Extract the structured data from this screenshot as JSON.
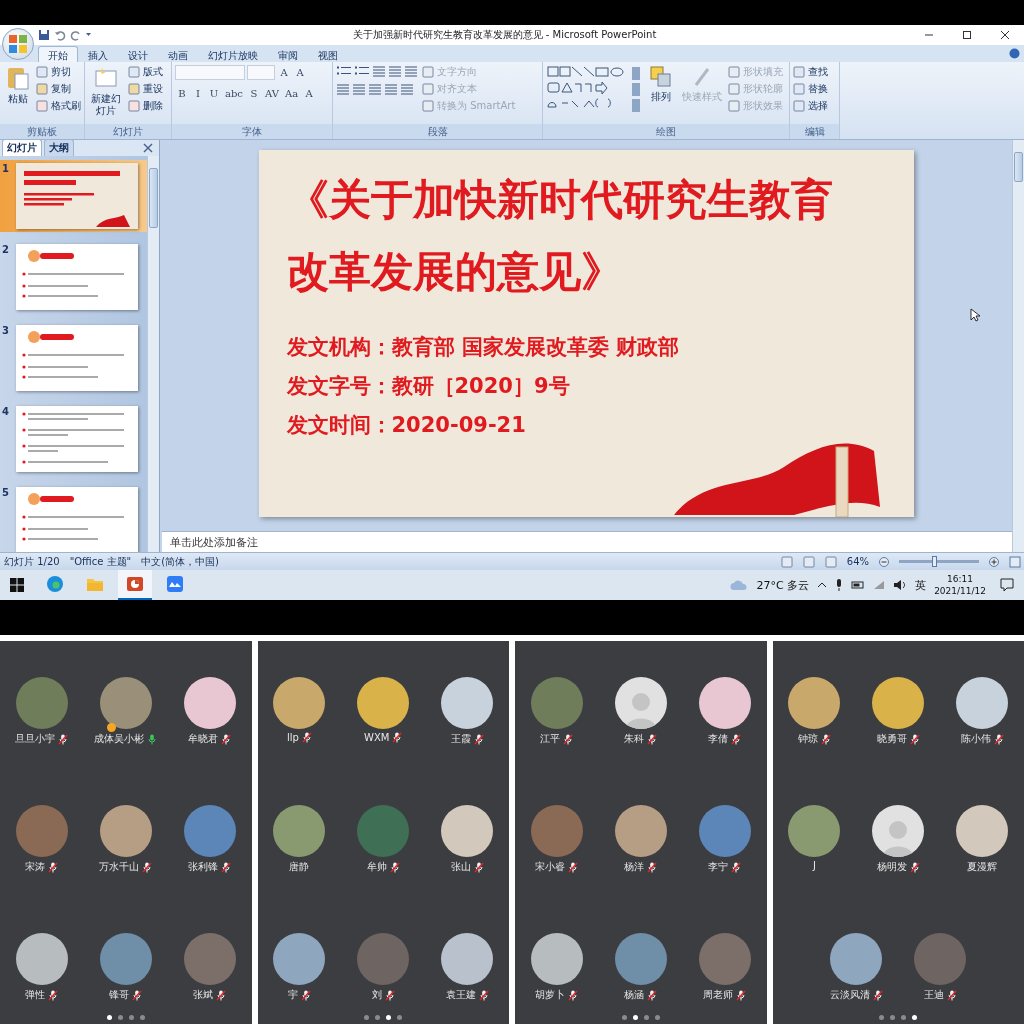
{
  "window": {
    "title": "关于加强新时代研究生教育改革发展的意见 - Microsoft PowerPoint"
  },
  "ribbon_tabs": [
    {
      "label": "开始",
      "selected": true
    },
    {
      "label": "插入",
      "selected": false
    },
    {
      "label": "设计",
      "selected": false
    },
    {
      "label": "动画",
      "selected": false
    },
    {
      "label": "幻灯片放映",
      "selected": false
    },
    {
      "label": "审阅",
      "selected": false
    },
    {
      "label": "视图",
      "selected": false
    }
  ],
  "ribbon_groups": [
    {
      "kind": "clipboard",
      "label": "剪贴板",
      "big_button": {
        "label": "粘贴",
        "disabled": false
      },
      "items": [
        {
          "label": "剪切",
          "disabled": false
        },
        {
          "label": "复制",
          "disabled": false
        },
        {
          "label": "格式刷",
          "disabled": false
        }
      ]
    },
    {
      "kind": "slides",
      "label": "幻灯片",
      "big_button": {
        "label": "新建幻灯片",
        "disabled": false
      },
      "items": [
        {
          "label": "版式",
          "disabled": false
        },
        {
          "label": "重设",
          "disabled": false
        },
        {
          "label": "删除",
          "disabled": false
        }
      ]
    },
    {
      "kind": "font",
      "label": "字体",
      "size_buttons": [
        "A",
        "A"
      ],
      "format_buttons": [
        "B",
        "I",
        "U",
        "abc",
        "S",
        "AV",
        "Aa",
        "A"
      ]
    },
    {
      "kind": "paragraph",
      "label": "段落",
      "items": [
        {
          "label": "文字方向",
          "disabled": true
        },
        {
          "label": "对齐文本",
          "disabled": true
        },
        {
          "label": "转换为 SmartArt",
          "disabled": true
        }
      ]
    },
    {
      "kind": "drawing",
      "label": "绘图",
      "big_buttons": [
        {
          "label": "排列",
          "disabled": false
        },
        {
          "label": "快速样式",
          "disabled": true
        }
      ],
      "items": [
        {
          "label": "形状填充",
          "disabled": true
        },
        {
          "label": "形状轮廓",
          "disabled": true
        },
        {
          "label": "形状效果",
          "disabled": true
        }
      ]
    },
    {
      "kind": "editing",
      "label": "编辑",
      "items": [
        {
          "label": "查找",
          "disabled": false
        },
        {
          "label": "替换",
          "disabled": false
        },
        {
          "label": "选择",
          "disabled": false
        }
      ]
    }
  ],
  "panel_tabs": [
    {
      "label": "幻灯片",
      "selected": true
    },
    {
      "label": "大纲",
      "selected": false
    }
  ],
  "thumbnails": [
    {
      "number": "1",
      "kind": "title",
      "selected": true
    },
    {
      "number": "2",
      "kind": "section",
      "selected": false
    },
    {
      "number": "3",
      "kind": "section",
      "selected": false
    },
    {
      "number": "4",
      "kind": "list",
      "selected": false
    },
    {
      "number": "5",
      "kind": "section",
      "selected": false
    }
  ],
  "slide": {
    "title": "《关于加快新时代研究生教育改革发展的意见》",
    "lines": [
      "发文机构：教育部 国家发展改革委 财政部",
      "发文字号：教研［2020］9号",
      "发文时间：2020-09-21"
    ]
  },
  "notes": {
    "placeholder": "单击此处添加备注"
  },
  "status_bar": {
    "items": [
      "幻灯片 1/20",
      "\"Office 主题\"",
      "中文(简体，中国)"
    ],
    "zoom": {
      "reading": "64%",
      "level": 0.45
    }
  },
  "taskbar": {
    "apps": [
      {
        "kind": "browser",
        "selected": false
      },
      {
        "kind": "folder",
        "selected": false
      },
      {
        "kind": "slides",
        "selected": true
      },
      {
        "kind": "meeting",
        "selected": false
      }
    ],
    "weather": "27°C 多云",
    "input_method": "英",
    "time": "16:11",
    "date": "2021/11/12"
  },
  "meeting_panels": [
    {
      "participants": [
        {
          "name": "旦旦小宇",
          "kind": "photo",
          "muted": true,
          "speaking": false,
          "host": false
        },
        {
          "name": "成体吴小彬",
          "kind": "photo",
          "muted": false,
          "speaking": true,
          "host": true
        },
        {
          "name": "牟晓君",
          "kind": "photo",
          "muted": true,
          "speaking": false,
          "host": false
        },
        {
          "name": "宋涛",
          "kind": "photo",
          "muted": true,
          "speaking": false,
          "host": false
        },
        {
          "name": "万水千山",
          "kind": "photo",
          "muted": true,
          "speaking": false,
          "host": false
        },
        {
          "name": "张利锋",
          "kind": "photo",
          "muted": true,
          "speaking": false,
          "host": false
        },
        {
          "name": "弹性",
          "kind": "photo",
          "muted": true,
          "speaking": false,
          "host": false
        },
        {
          "name": "锋哥",
          "kind": "photo",
          "muted": true,
          "speaking": false,
          "host": false
        },
        {
          "name": "张斌",
          "kind": "photo",
          "muted": true,
          "speaking": false,
          "host": false
        }
      ],
      "page_dots": [
        {
          "selected": true
        },
        {
          "selected": false
        },
        {
          "selected": false
        },
        {
          "selected": false
        }
      ]
    },
    {
      "participants": [
        {
          "name": "llp",
          "kind": "photo",
          "muted": true,
          "speaking": false,
          "host": false
        },
        {
          "name": "WXM",
          "kind": "photo",
          "muted": true,
          "speaking": false,
          "host": false
        },
        {
          "name": "王霞",
          "kind": "photo",
          "muted": true,
          "speaking": false,
          "host": false
        },
        {
          "name": "唐静",
          "kind": "photo",
          "muted": false,
          "speaking": false,
          "host": false
        },
        {
          "name": "牟帅",
          "kind": "photo",
          "muted": true,
          "speaking": false,
          "host": false
        },
        {
          "name": "张山",
          "kind": "photo",
          "muted": true,
          "speaking": false,
          "host": false
        },
        {
          "name": "宇",
          "kind": "photo",
          "muted": true,
          "speaking": false,
          "host": false
        },
        {
          "name": "刘",
          "kind": "photo",
          "muted": true,
          "speaking": false,
          "host": false
        },
        {
          "name": "袁王建",
          "kind": "photo",
          "muted": true,
          "speaking": false,
          "host": false
        }
      ],
      "page_dots": [
        {
          "selected": false
        },
        {
          "selected": false
        },
        {
          "selected": true
        },
        {
          "selected": false
        }
      ]
    },
    {
      "participants": [
        {
          "name": "江平",
          "kind": "photo",
          "muted": true,
          "speaking": false,
          "host": false
        },
        {
          "name": "朱科",
          "kind": "default",
          "muted": true,
          "speaking": false,
          "host": false
        },
        {
          "name": "李倩",
          "kind": "photo",
          "muted": true,
          "speaking": false,
          "host": false
        },
        {
          "name": "宋小睿",
          "kind": "photo",
          "muted": true,
          "speaking": false,
          "host": false
        },
        {
          "name": "杨洋",
          "kind": "photo",
          "muted": true,
          "speaking": false,
          "host": false
        },
        {
          "name": "李宁",
          "kind": "photo",
          "muted": true,
          "speaking": false,
          "host": false
        },
        {
          "name": "胡萝卜",
          "kind": "photo",
          "muted": true,
          "speaking": false,
          "host": false
        },
        {
          "name": "杨涵",
          "kind": "photo",
          "muted": true,
          "speaking": false,
          "host": false
        },
        {
          "name": "周老师",
          "kind": "photo",
          "muted": true,
          "speaking": false,
          "host": false
        }
      ],
      "page_dots": [
        {
          "selected": false
        },
        {
          "selected": true
        },
        {
          "selected": false
        },
        {
          "selected": false
        }
      ]
    },
    {
      "participants": [
        {
          "name": "钟琼",
          "kind": "photo",
          "muted": true,
          "speaking": false,
          "host": false
        },
        {
          "name": "晓勇哥",
          "kind": "photo",
          "muted": true,
          "speaking": false,
          "host": false
        },
        {
          "name": "陈小伟",
          "kind": "photo",
          "muted": true,
          "speaking": false,
          "host": false
        },
        {
          "name": "J",
          "kind": "photo",
          "muted": false,
          "speaking": false,
          "host": false
        },
        {
          "name": "杨明发",
          "kind": "default",
          "muted": true,
          "speaking": false,
          "host": false
        },
        {
          "name": "夏漫辉",
          "kind": "photo",
          "muted": false,
          "speaking": false,
          "host": false
        },
        {
          "name": "云淡风清",
          "kind": "photo",
          "muted": true,
          "speaking": false,
          "host": false
        },
        {
          "name": "王迪",
          "kind": "photo",
          "muted": true,
          "speaking": false,
          "host": false
        }
      ],
      "page_dots": [
        {
          "selected": false
        },
        {
          "selected": false
        },
        {
          "selected": false
        },
        {
          "selected": true
        }
      ]
    }
  ]
}
